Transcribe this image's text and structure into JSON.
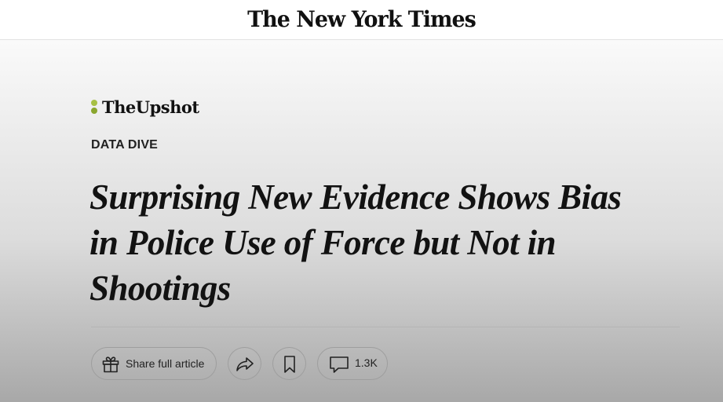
{
  "masthead": {
    "logo_text": "The New York Times"
  },
  "section": {
    "brand_name": "TheUpshot",
    "brand_dot_color": "#a7c044"
  },
  "article": {
    "kicker": "DATA DIVE",
    "headline": "Surprising New Evidence Shows Bias in Police Use of Force but Not in Shootings"
  },
  "actions": {
    "share_full_article_label": "Share full article",
    "share_full_article_icon": "gift-icon",
    "forward_icon": "share-arrow-icon",
    "save_icon": "bookmark-icon",
    "comments_icon": "comment-bubble-icon",
    "comment_count": "1.3K"
  }
}
